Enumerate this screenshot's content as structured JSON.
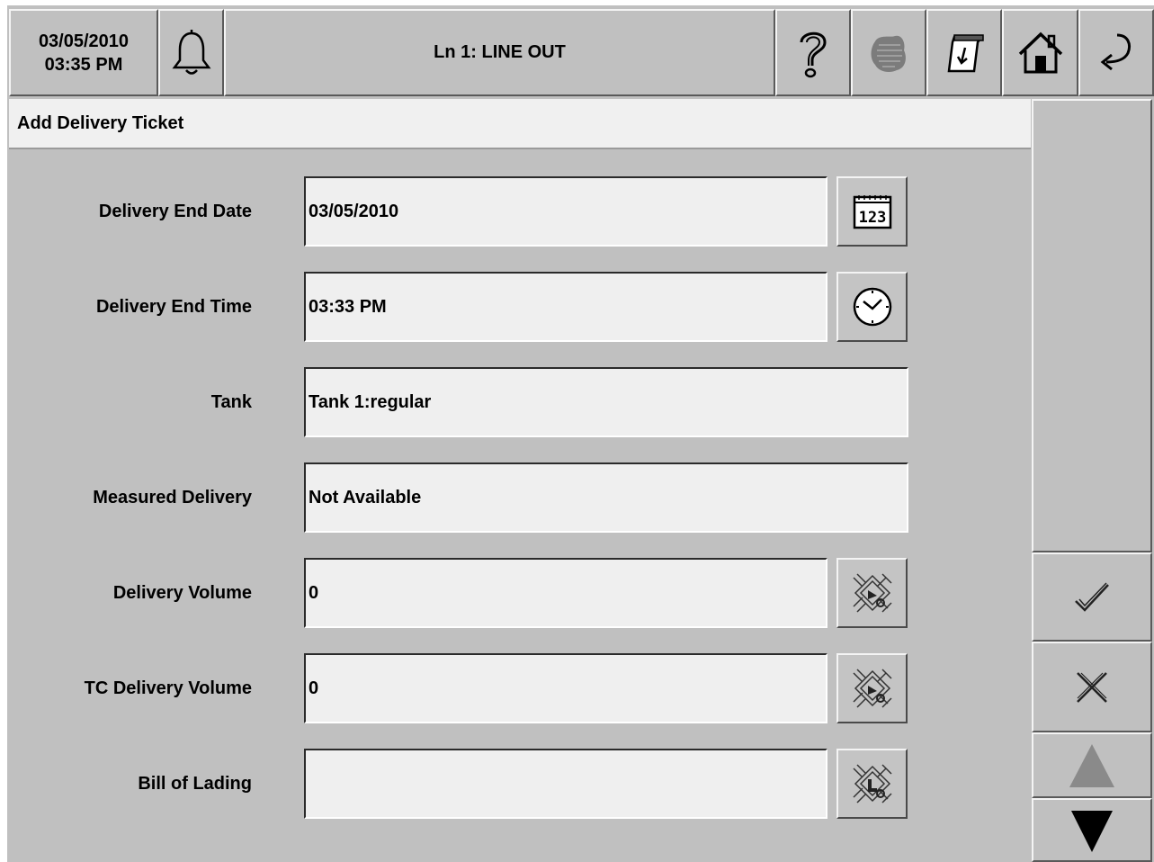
{
  "topbar": {
    "date": "03/05/2010",
    "time": "03:35 PM",
    "title": "Ln 1: LINE OUT",
    "icons": [
      "bell-icon",
      "help-icon",
      "alarm-blob-icon",
      "report-paper-icon",
      "home-icon",
      "back-arrow-icon"
    ]
  },
  "page": {
    "title": "Add Delivery Ticket"
  },
  "form": {
    "delivery_end_date": {
      "label": "Delivery End Date",
      "value": "03/05/2010",
      "button_icon": "calendar-icon"
    },
    "delivery_end_time": {
      "label": "Delivery End Time",
      "value": "03:33 PM",
      "button_icon": "clock-icon"
    },
    "tank": {
      "label": "Tank",
      "value": "Tank 1:regular"
    },
    "measured_delivery": {
      "label": "Measured Delivery",
      "value": "Not Available"
    },
    "delivery_volume": {
      "label": "Delivery Volume",
      "value": "0",
      "button_icon": "keypad-icon"
    },
    "tc_delivery_volume": {
      "label": "TC Delivery Volume",
      "value": "0",
      "button_icon": "keypad-icon"
    },
    "bill_of_lading": {
      "label": "Bill of Lading",
      "value": "",
      "button_icon": "keyboard-icon"
    }
  },
  "sidebar": {
    "icons": [
      "checkmark-icon",
      "x-cancel-icon",
      "scroll-up-icon",
      "scroll-down-icon"
    ]
  },
  "colors": {
    "panel_gray": "#c0c0c0",
    "field_bg": "#efefef",
    "header_bg": "#f0f0f0"
  }
}
